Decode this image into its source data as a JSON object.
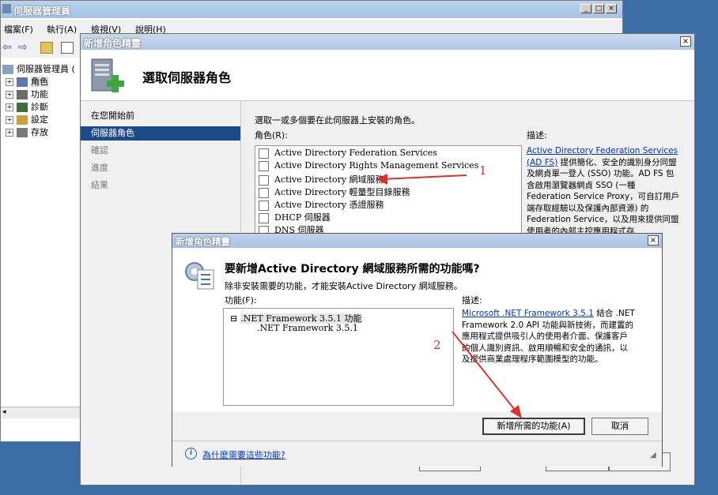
{
  "server_manager": {
    "title": "伺服器管理員",
    "menu": [
      "檔案(F)",
      "執行(A)",
      "檢視(V)",
      "說明(H)"
    ],
    "window_buttons": [
      "_",
      "□",
      "×"
    ],
    "tree": [
      {
        "label": "伺服器管理員 (",
        "icon": "server-icon"
      },
      {
        "label": "角色",
        "icon": "roles-icon"
      },
      {
        "label": "功能",
        "icon": "features-icon"
      },
      {
        "label": "診斷",
        "icon": "diagnostics-icon"
      },
      {
        "label": "設定",
        "icon": "configuration-icon"
      },
      {
        "label": "存放",
        "icon": "storage-icon"
      }
    ]
  },
  "wizard": {
    "title": "新增角色精靈",
    "close": "×",
    "header_title": "選取伺服器角色",
    "nav": [
      {
        "label": "在您開始前",
        "state": "done"
      },
      {
        "label": "伺服器角色",
        "state": "active"
      },
      {
        "label": "確認",
        "state": "pending"
      },
      {
        "label": "進度",
        "state": "pending"
      },
      {
        "label": "結果",
        "state": "pending"
      }
    ],
    "instruction": "選取一或多個要在此伺服器上安裝的角色。",
    "roles_label": "角色(R):",
    "roles": [
      "Active Directory Federation Services",
      "Active Directory Rights Management Services",
      "Active Directory 網域服務",
      "Active Directory 輕量型目錄服務",
      "Active Directory 憑證服務",
      "DHCP 伺服器",
      "DNS 伺服器"
    ],
    "description_label": "描述:",
    "description_link": "Active Directory Federation Services (AD FS)",
    "description_text": " 提供簡化、安全的識別身分同盟及網貞單一登人 (SSO) 功能。AD FS 包含啟用瀏覽器網貞 SSO (一種 Federation Service Proxy，可自訂用戶端存取經驗以及保護內部資源) 的 Federation Service，以及用來提供同盟使用者的內部主控應用程式存"
  },
  "dialog": {
    "title": "新增角色精靈",
    "close": "×",
    "heading": "要新增Active Directory 網域服務所需的功能嗎?",
    "subtitle": "除非安裝需要的功能，才能安裝Active Directory 網域服務。",
    "features_label": "功能(F):",
    "features": [
      {
        "label": ".NET Framework 3.5.1 功能",
        "toggle": "⊟"
      },
      {
        "label": ".NET Framework 3.5.1",
        "toggle": ""
      }
    ],
    "description_label": "描述:",
    "description_link": "Microsoft .NET Framework 3.5.1",
    "description_text": " 結合 .NET Framework 2.0 API 功能與新技術，而建置的應用程式提供吸引人的使用者介面、保護客戶的個人識別資訊、啟用順暢和安全的通訊，以及提供商業處理程序範圍模型的功能。",
    "add_button": "新增所需的功能(A)",
    "cancel_button": "取消",
    "help_link": "為什麼需要這些功能?"
  },
  "annotations": {
    "label1": "1",
    "label2": "2",
    "color": "#e0302a"
  }
}
